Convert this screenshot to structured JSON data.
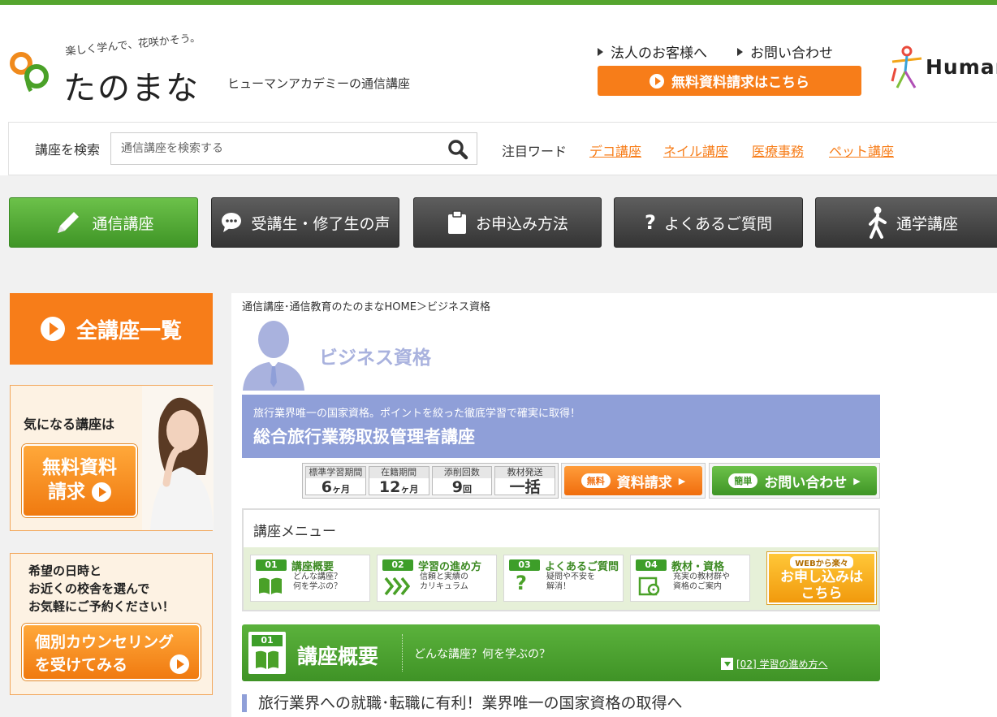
{
  "header": {
    "tagline": "楽しく学んで、花咲かそう。",
    "logo_text": "たのまな",
    "logo_sub": "ヒューマンアカデミーの通信講座",
    "corporate_link": "法人のお客様へ",
    "contact_link": "お問い合わせ",
    "cta_label": "無料資料請求はこちら",
    "partner_logo_text": "Human"
  },
  "search": {
    "label": "講座を検索",
    "placeholder": "通信講座を検索する",
    "keywords_label": "注目ワード",
    "keywords": [
      "デコ講座",
      "ネイル講座",
      "医療事務",
      "ペット講座"
    ]
  },
  "nav": {
    "items": [
      {
        "label": "通信講座",
        "icon": "pencil-icon"
      },
      {
        "label": "受講生・修了生の声",
        "icon": "speech-bubble-icon"
      },
      {
        "label": "お申込み方法",
        "icon": "clipboard-icon"
      },
      {
        "label": "よくあるご質問",
        "icon": "question-icon"
      },
      {
        "label": "通学講座",
        "icon": "walking-person-icon"
      }
    ]
  },
  "sidebar": {
    "all_courses": "全講座一覧",
    "card1": {
      "title": "気になる講座は",
      "button_line1": "無料資料",
      "button_line2": "請求"
    },
    "card2": {
      "line1": "希望の日時と",
      "line2": "お近くの校舎を選んで",
      "line3": "お気軽にご予約ください！",
      "button_line1": "個別カウンセリング",
      "button_line2": "を受けてみる"
    }
  },
  "main": {
    "breadcrumb": "通信講座･通信教育のたのまなHOME＞ビジネス資格",
    "category_title": "ビジネス資格",
    "course_lead": "旅行業界唯一の国家資格。ポイントを絞った徹底学習で確実に取得！",
    "course_name": "総合旅行業務取扱管理者講座",
    "stats": [
      {
        "label": "標準学習期間",
        "value": "6",
        "unit": "ヶ月"
      },
      {
        "label": "在籍期間",
        "value": "12",
        "unit": "ヶ月"
      },
      {
        "label": "添削回数",
        "value": "9",
        "unit": "回"
      },
      {
        "label": "教材発送",
        "value": "一括",
        "unit": ""
      }
    ],
    "request_pill": "無料",
    "request_label": "資料請求",
    "inquiry_pill": "簡単",
    "inquiry_label": "お問い合わせ",
    "menu_title": "講座メニュー",
    "menu_items": [
      {
        "num": "01",
        "title": "講座概要",
        "desc1": "どんな講座？",
        "desc2": "何を学ぶの？"
      },
      {
        "num": "02",
        "title": "学習の進め方",
        "desc1": "信頼と実績の",
        "desc2": "カリキュラム"
      },
      {
        "num": "03",
        "title": "よくあるご質問",
        "desc1": "疑問や不安を",
        "desc2": "解消！"
      },
      {
        "num": "04",
        "title": "教材・資格",
        "desc1": "充実の教材群や",
        "desc2": "資格のご案内"
      }
    ],
    "apply_small": "WEBから楽々",
    "apply_line1": "お申し込みは",
    "apply_line2": "こちら",
    "section": {
      "num": "01",
      "title": "講座概要",
      "subtitle": "どんな講座？何を学ぶの？",
      "next_link": "[02] 学習の進め方へ"
    },
    "section_lead": "旅行業界への就職･転職に有利！業界唯一の国家資格の取得へ"
  },
  "colors": {
    "brand_green": "#55a52e",
    "accent_orange": "#f77d19",
    "category_blue": "#8f9fd8"
  }
}
